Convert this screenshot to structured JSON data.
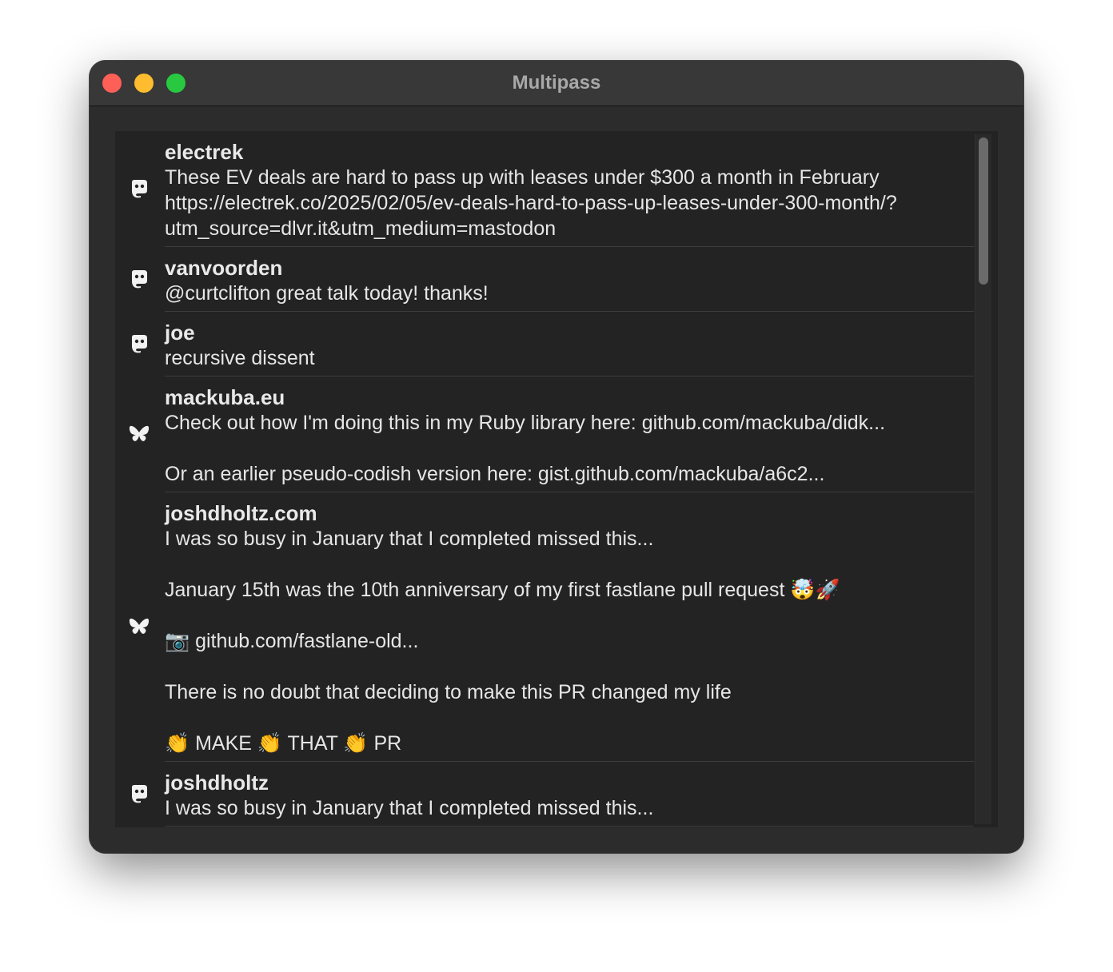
{
  "window": {
    "title": "Multipass"
  },
  "feed": [
    {
      "service": "mastodon-icon",
      "author": "electrek",
      "text": "These EV deals are hard to pass up with leases under $300 a month in February https://electrek.co/2025/02/05/ev-deals-hard-to-pass-up-leases-under-300-month/?utm_source=dlvr.it&utm_medium=mastodon"
    },
    {
      "service": "mastodon-icon",
      "author": "vanvoorden",
      "text": "@curtclifton great talk today! thanks!"
    },
    {
      "service": "mastodon-icon",
      "author": "joe",
      "text": "recursive dissent"
    },
    {
      "service": "bluesky-icon",
      "author": "mackuba.eu",
      "text": "Check out how I'm doing this in my Ruby library here: github.com/mackuba/didk...\n\nOr an earlier pseudo-codish version here: gist.github.com/mackuba/a6c2..."
    },
    {
      "service": "bluesky-icon",
      "author": "joshdholtz.com",
      "text": "I was so busy in January that I completed missed this...\n\nJanuary 15th was the 10th anniversary of my first fastlane pull request 🤯🚀\n\n📷 github.com/fastlane-old...\n\nThere is no doubt that deciding to make this PR changed my life\n\n👏 MAKE 👏 THAT 👏 PR"
    },
    {
      "service": "mastodon-icon",
      "author": "joshdholtz",
      "text": "I was so busy in January that I completed missed this..."
    }
  ]
}
